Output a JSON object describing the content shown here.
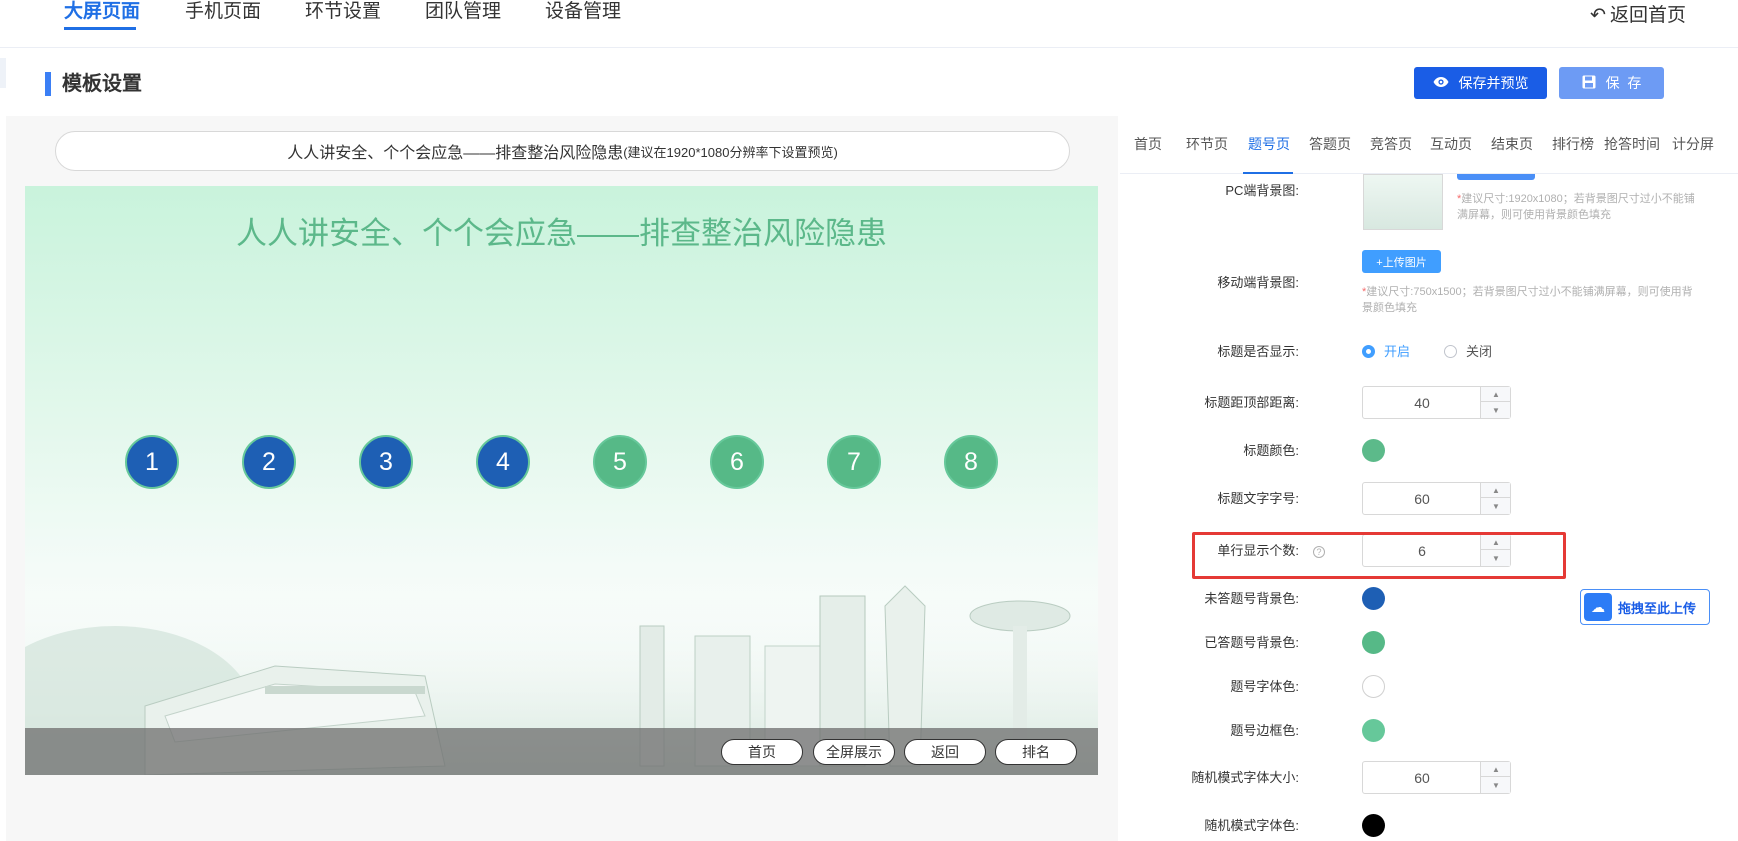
{
  "nav": {
    "items": [
      "大屏页面",
      "手机页面",
      "环节设置",
      "团队管理",
      "设备管理"
    ],
    "back_home": "返回首页"
  },
  "section": {
    "title": "模板设置",
    "preview_button": "保存并预览",
    "save_button": "保  存"
  },
  "preview": {
    "title_input_value": "人人讲安全、个个会应急——排查整治风险隐患",
    "title_input_hint": "(建议在1920*1080分辨率下设置预览)",
    "screen_title": "人人讲安全、个个会应急——排查整治风险隐患",
    "numbers": [
      {
        "label": "1",
        "state": "unanswered"
      },
      {
        "label": "2",
        "state": "unanswered"
      },
      {
        "label": "3",
        "state": "unanswered"
      },
      {
        "label": "4",
        "state": "unanswered"
      },
      {
        "label": "5",
        "state": "answered"
      },
      {
        "label": "6",
        "state": "answered"
      },
      {
        "label": "7",
        "state": "answered"
      },
      {
        "label": "8",
        "state": "answered"
      }
    ],
    "buttons": [
      "首页",
      "全屏展示",
      "返回",
      "排名"
    ]
  },
  "tabs": {
    "items": [
      "首页",
      "环节页",
      "题号页",
      "答题页",
      "竞答页",
      "互动页",
      "结束页",
      "排行榜",
      "抢答时间",
      "计分屏"
    ],
    "active": "题号页"
  },
  "settings": {
    "pc_bg_label": "PC端背景图:",
    "pc_bg_note": "建议尺寸:1920x1080；若背景图尺寸过小不能铺满屏幕，则可使用背景颜色填充",
    "mobile_bg_label": "移动端背景图:",
    "upload_button": "+上传图片",
    "mobile_bg_note": "建议尺寸:750x1500；若背景图尺寸过小不能铺满屏幕，则可使用背景颜色填充",
    "title_show_label": "标题是否显示:",
    "title_show_on": "开启",
    "title_show_off": "关闭",
    "title_top_label": "标题距顶部距离:",
    "title_top_value": "40",
    "title_color_label": "标题颜色:",
    "title_font_label": "标题文字字号:",
    "title_font_value": "60",
    "per_row_label": "单行显示个数:",
    "per_row_value": "6",
    "unanswered_bg_label": "未答题号背景色:",
    "answered_bg_label": "已答题号背景色:",
    "num_font_color_label": "题号字体色:",
    "num_border_color_label": "题号边框色:",
    "random_font_size_label": "随机模式字体大小:",
    "random_font_size_value": "60",
    "random_font_color_label": "随机模式字体色:"
  },
  "colors": {
    "title_color": "#5cba8a",
    "unanswered_bg": "#1e5fb4",
    "answered_bg": "#56b987",
    "num_font_color": "#ffffff",
    "num_border_color": "#66c89a",
    "random_font_color": "#000000"
  },
  "drag_upload": "拖拽至此上传"
}
